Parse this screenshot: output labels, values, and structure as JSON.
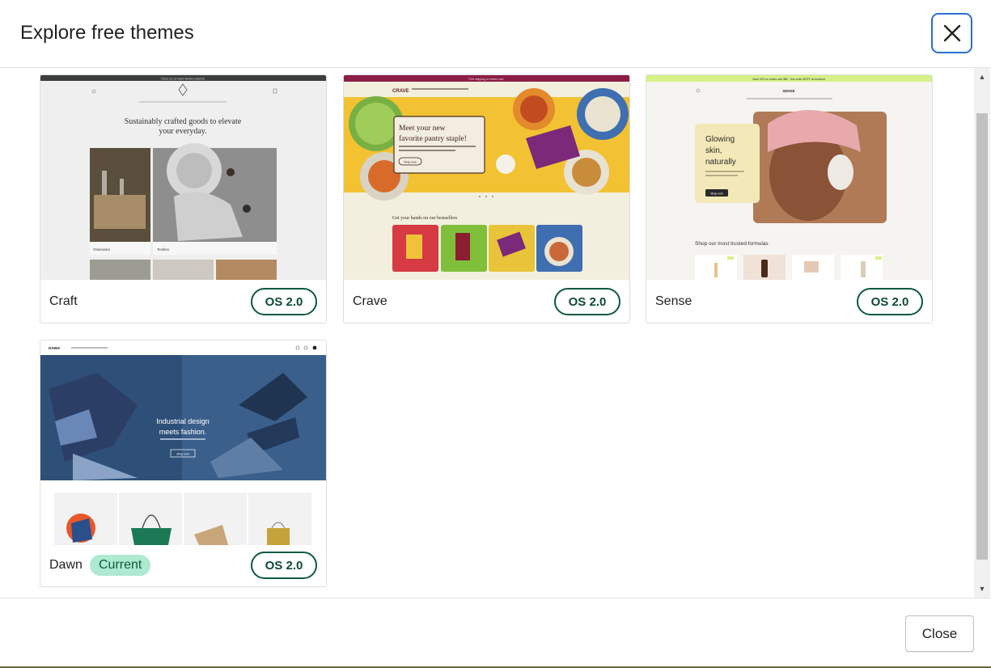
{
  "modal": {
    "title": "Explore free themes",
    "close_label": "Close"
  },
  "themes": [
    {
      "name": "Craft",
      "badge": "OS 2.0",
      "preview": {
        "banner": "Check out our latest handles collection",
        "headline_1": "Sustainably crafted goods to elevate",
        "headline_2": "your everyday.",
        "tile_1": "Glassware",
        "tile_2": "Textiles"
      }
    },
    {
      "name": "Crave",
      "badge": "OS 2.0",
      "preview": {
        "banner": "Free shipping on orders over",
        "logo": "CRAVE",
        "hero_1": "Meet your new",
        "hero_2": "favorite pantry staple!",
        "hero_btn": "Shop now",
        "section": "Get your hands on our bestsellers"
      }
    },
    {
      "name": "Sense",
      "badge": "OS 2.0",
      "preview": {
        "banner": "Save 15% on orders over $80 · Use code 15OFF at checkout",
        "logo": "SENSE",
        "hero_1": "Glowing",
        "hero_2": "skin,",
        "hero_3": "naturally",
        "hero_btn": "Shop now",
        "section": "Shop our most trusted formulas"
      }
    },
    {
      "name": "Dawn",
      "badge": "OS 2.0",
      "current": "Current",
      "preview": {
        "logo": "DAWN",
        "hero_1": "Industrial design",
        "hero_2": "meets fashion.",
        "hero_btn": "Shop now"
      }
    }
  ],
  "colors": {
    "accent_green": "#0b5a3e",
    "current_badge": "#aee9d1",
    "focus_blue": "#2c6ecb"
  },
  "icons": {
    "close": "close-icon",
    "scroll_up": "scroll-up-arrow-icon",
    "scroll_down": "scroll-down-arrow-icon"
  }
}
